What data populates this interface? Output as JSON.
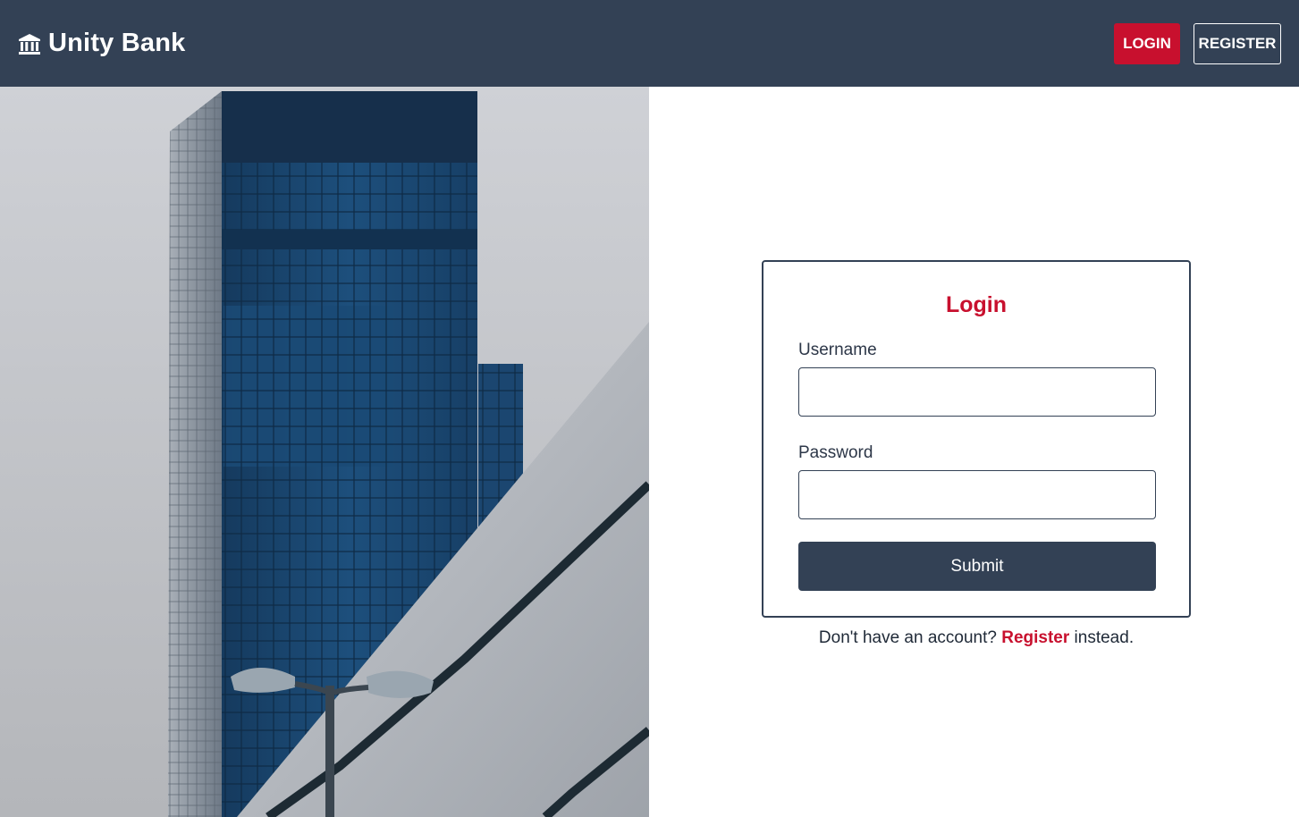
{
  "brand": {
    "icon": "bank-icon",
    "name": "Unity Bank"
  },
  "nav": {
    "login_label": "LOGIN",
    "register_label": "REGISTER"
  },
  "hero": {
    "image": "office-tower-photo"
  },
  "login_form": {
    "title": "Login",
    "username_label": "Username",
    "username_value": "",
    "password_label": "Password",
    "password_value": "",
    "submit_label": "Submit"
  },
  "register_prompt": {
    "prefix": "Don't have an account?",
    "link": "Register",
    "suffix": "instead."
  },
  "colors": {
    "navbar": "#334155",
    "accent": "#c8102e",
    "submit": "#334155"
  }
}
